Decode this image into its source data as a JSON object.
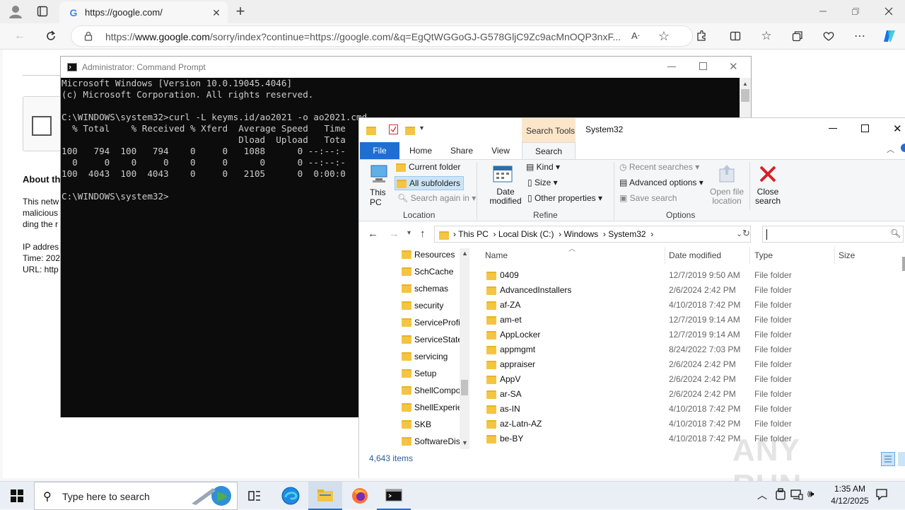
{
  "browser": {
    "tab_title": "https://google.com/",
    "url_prefix": "https://",
    "url_domain": "www.google.com",
    "url_rest": "/sorry/index?continue=https://google.com/&q=EgQtWGGoGJ-G578GljC9Zc9acMnOQP3nxF...",
    "tab_favicon": "G"
  },
  "google_page": {
    "about": "About th",
    "line1": "This netw",
    "line2": "malicious",
    "line3": "ding the r",
    "ip": "IP addres",
    "time": "Time: 202",
    "url": "URL: http"
  },
  "cmd": {
    "title": "Administrator: Command Prompt",
    "lines": [
      "Microsoft Windows [Version 10.0.19045.4046]",
      "(c) Microsoft Corporation. All rights reserved.",
      "",
      "C:\\WINDOWS\\system32>curl -L keyms.id/ao2021 -o ao2021.cmd",
      "  % Total    % Received % Xferd  Average Speed   Time",
      "                                 Dload  Upload   Tota",
      "100   794  100   794    0     0   1088      0 --:--:-",
      "  0     0    0     0    0     0      0      0 --:--:-",
      "100  4043  100  4043    0     0   2105      0  0:00:0",
      "",
      "C:\\WINDOWS\\system32>"
    ]
  },
  "explorer": {
    "context_tab": "Search Tools",
    "window_title": "System32",
    "ribbon_tabs": [
      "File",
      "Home",
      "Share",
      "View",
      "Search"
    ],
    "location": {
      "this_pc": "This PC",
      "current_folder": "Current folder",
      "all_subfolders": "All subfolders",
      "search_again": "Search again in",
      "group": "Location"
    },
    "refine": {
      "date_modified": "Date modified",
      "kind": "Kind",
      "size": "Size",
      "other": "Other properties",
      "group": "Refine"
    },
    "options": {
      "recent": "Recent searches",
      "advanced": "Advanced options",
      "save": "Save search",
      "open_file_location": "Open file location",
      "close_search": "Close search",
      "group": "Options"
    },
    "breadcrumb": [
      "This PC",
      "Local Disk (C:)",
      "Windows",
      "System32"
    ],
    "columns": [
      "Name",
      "Date modified",
      "Type",
      "Size"
    ],
    "nav_items": [
      "Resources",
      "SchCache",
      "schemas",
      "security",
      "ServiceProfi",
      "ServiceState",
      "servicing",
      "Setup",
      "ShellCompo",
      "ShellExperie",
      "SKB",
      "SoftwareDis"
    ],
    "files": [
      {
        "name": "0409",
        "date": "12/7/2019 9:50 AM",
        "type": "File folder"
      },
      {
        "name": "AdvancedInstallers",
        "date": "2/6/2024 2:42 PM",
        "type": "File folder"
      },
      {
        "name": "af-ZA",
        "date": "4/10/2018 7:42 PM",
        "type": "File folder"
      },
      {
        "name": "am-et",
        "date": "12/7/2019 9:14 AM",
        "type": "File folder"
      },
      {
        "name": "AppLocker",
        "date": "12/7/2019 9:14 AM",
        "type": "File folder"
      },
      {
        "name": "appmgmt",
        "date": "8/24/2022 7:03 PM",
        "type": "File folder"
      },
      {
        "name": "appraiser",
        "date": "2/6/2024 2:42 PM",
        "type": "File folder"
      },
      {
        "name": "AppV",
        "date": "2/6/2024 2:42 PM",
        "type": "File folder"
      },
      {
        "name": "ar-SA",
        "date": "2/6/2024 2:42 PM",
        "type": "File folder"
      },
      {
        "name": "as-IN",
        "date": "4/10/2018 7:42 PM",
        "type": "File folder"
      },
      {
        "name": "az-Latn-AZ",
        "date": "4/10/2018 7:42 PM",
        "type": "File folder"
      },
      {
        "name": "be-BY",
        "date": "4/10/2018 7:42 PM",
        "type": "File folder"
      }
    ],
    "status": "4,643 items"
  },
  "taskbar": {
    "search_placeholder": "Type here to search",
    "time": "1:35 AM",
    "date": "4/12/2025"
  },
  "watermark": "ANY RUN"
}
